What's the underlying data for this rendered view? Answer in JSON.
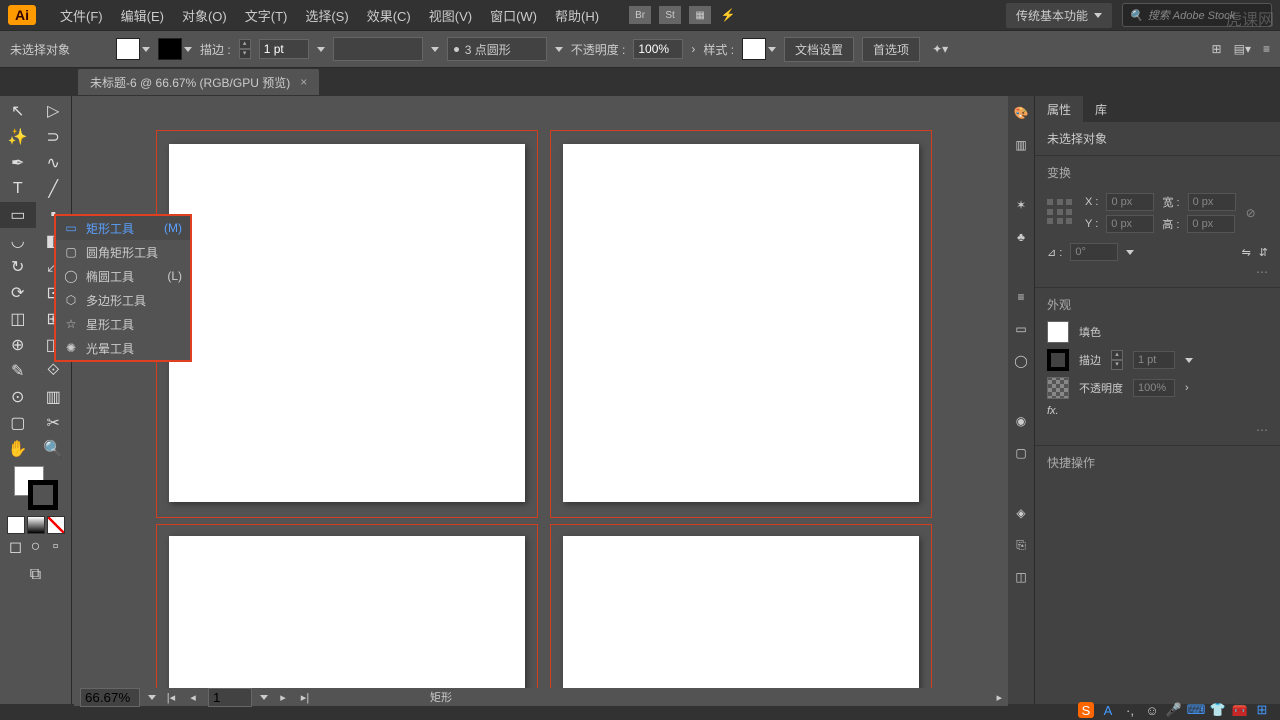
{
  "menu": {
    "file": "文件(F)",
    "edit": "编辑(E)",
    "object": "对象(O)",
    "type": "文字(T)",
    "select": "选择(S)",
    "effect": "效果(C)",
    "view": "视图(V)",
    "window": "窗口(W)",
    "help": "帮助(H)"
  },
  "workspace": "传统基本功能",
  "search_placeholder": "搜索 Adobe Stock",
  "logo": "Ai",
  "ctrl": {
    "no_selection": "未选择对象",
    "stroke_label": "描边 :",
    "stroke_val": "1 pt",
    "brush": "3 点圆形",
    "opacity_label": "不透明度 :",
    "opacity_val": "100%",
    "style_label": "样式 :",
    "doc_setup": "文档设置",
    "prefs": "首选项"
  },
  "doc_tab": "未标题-6 @ 66.67% (RGB/GPU 预览)",
  "flyout": {
    "rect": "矩形工具",
    "rect_key": "(M)",
    "rrect": "圆角矩形工具",
    "ellipse": "椭圆工具",
    "ellipse_key": "(L)",
    "polygon": "多边形工具",
    "star": "星形工具",
    "flare": "光晕工具"
  },
  "panel": {
    "prop_tab": "属性",
    "lib_tab": "库",
    "no_sel": "未选择对象",
    "transform": "变换",
    "x": "X :",
    "y": "Y :",
    "w": "宽 :",
    "h": "高 :",
    "angle": "⊿ :",
    "val0": "0 px",
    "deg0": "0°",
    "appearance": "外观",
    "fill": "填色",
    "stroke": "描边",
    "stroke_val": "1 pt",
    "opacity": "不透明度",
    "opacity_val": "100%",
    "fx": "fx.",
    "quick": "快捷操作"
  },
  "status": {
    "zoom": "66.67%",
    "artboard": "1",
    "tool": "矩形"
  },
  "watermark": "虎课网"
}
